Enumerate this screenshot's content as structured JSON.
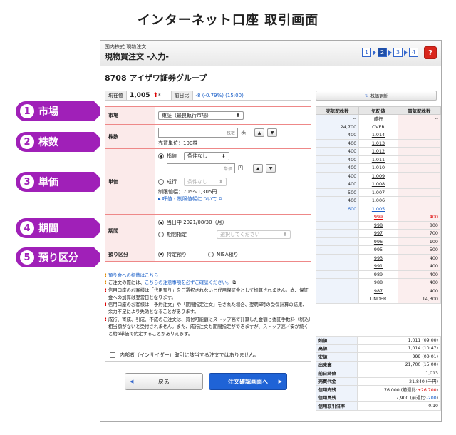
{
  "page_title": "インターネット口座 取引画面",
  "callouts": [
    {
      "num": "1",
      "label": "市場"
    },
    {
      "num": "2",
      "label": "株数"
    },
    {
      "num": "3",
      "label": "単価"
    },
    {
      "num": "4",
      "label": "期間"
    },
    {
      "num": "5",
      "label": "預り区分"
    }
  ],
  "header": {
    "crumb": "国内株式 現物注文",
    "title": "現物買注文 -入力-",
    "steps": [
      "1",
      "2",
      "3",
      "4"
    ],
    "active_step": 2,
    "help": "?"
  },
  "stock": {
    "name": "8708 アイザワ証券グループ",
    "price_label": "現在値",
    "price": "1,005",
    "price_arrow": "⬆",
    "price_mark": "*",
    "change_label": "前日比",
    "change": "-8 (-0.79%) (15:00)",
    "refresh": "株価更新"
  },
  "form": {
    "market_label": "市場",
    "market_value": "東証（最良執行市場）",
    "qty_label": "株数",
    "qty_placeholder": "株数",
    "qty_unit": "株",
    "qty_unit_note": "売買単位：100株",
    "price_label": "単価",
    "limit_label": "指値",
    "limit_cond": "条件なし",
    "price_placeholder": "単価",
    "price_unit": "円",
    "market_order_label": "成行",
    "market_order_cond": "条件なし",
    "price_range": "制限値幅：705～1,305円",
    "quote_link": "呼値・制限値幅について",
    "term_label": "期間",
    "term_today": "当日中 2021/08/30（月）",
    "term_specify": "期間指定",
    "term_select": "選択してください",
    "deposit_label": "預り区分",
    "deposit_special": "特定預り",
    "deposit_nisa": "NISA預り"
  },
  "notes": [
    {
      "icon": "!",
      "type": "o",
      "text": "預り金への振替はこちら",
      "blue": true
    },
    {
      "icon": "!",
      "type": "o",
      "text_pre": "ご注文の際には、",
      "text_link": "こちらの注意事項を必ずご確認ください。",
      "text_post": ""
    },
    {
      "icon": "!",
      "type": "r",
      "text": "信用口座のお客様は「代用預り」をご選択されないと代用保証金として加算されません。尚、保証金への加算は翌営日となります。"
    },
    {
      "icon": "!",
      "type": "r",
      "text": "信用口座のお客様は「予約注文」や「期間指定注文」をされた場合、翌朝6時の受保計算の結果、余力不足により失効となることがあります。"
    },
    {
      "icon": "!",
      "type": "r",
      "text": "成行、寄成、引成、不成のご注文は、買付可能額にストップ高で計算した金額と委託手数料（税込）相当額がないと受付されません。また、成行注文も期間指定ができますが、ストップ高／安が続くと約a単価で約定することがありえます。"
    }
  ],
  "insider": "内部者（インサイダー）取引に該当する注文ではありません。",
  "buttons": {
    "back": "戻る",
    "next": "注文確認画面へ"
  },
  "board": {
    "headers": [
      "売気配株数",
      "気配値",
      "買気配株数"
    ],
    "rows": [
      {
        "ask": "--",
        "price": "成行",
        "bid": "--",
        "plain": true
      },
      {
        "ask": "24,700",
        "price": "OVER",
        "bid": "",
        "plain": true
      },
      {
        "ask": "400",
        "price": "1,014",
        "bid": ""
      },
      {
        "ask": "400",
        "price": "1,013",
        "bid": ""
      },
      {
        "ask": "400",
        "price": "1,012",
        "bid": ""
      },
      {
        "ask": "400",
        "price": "1,011",
        "bid": ""
      },
      {
        "ask": "400",
        "price": "1,010",
        "bid": ""
      },
      {
        "ask": "400",
        "price": "1,009",
        "bid": ""
      },
      {
        "ask": "400",
        "price": "1,008",
        "bid": ""
      },
      {
        "ask": "500",
        "price": "1,007",
        "bid": ""
      },
      {
        "ask": "400",
        "price": "1,006",
        "bid": ""
      },
      {
        "ask": "600",
        "price": "1,005",
        "bid": "",
        "blue": true
      },
      {
        "ask": "",
        "price": "999",
        "bid": "400",
        "red": true
      },
      {
        "ask": "",
        "price": "998",
        "bid": "800"
      },
      {
        "ask": "",
        "price": "997",
        "bid": "700"
      },
      {
        "ask": "",
        "price": "996",
        "bid": "100"
      },
      {
        "ask": "",
        "price": "995",
        "bid": "500"
      },
      {
        "ask": "",
        "price": "993",
        "bid": "400"
      },
      {
        "ask": "",
        "price": "991",
        "bid": "400"
      },
      {
        "ask": "",
        "price": "989",
        "bid": "400"
      },
      {
        "ask": "",
        "price": "988",
        "bid": "400"
      },
      {
        "ask": "",
        "price": "987",
        "bid": "400"
      },
      {
        "ask": "",
        "price": "UNDER",
        "bid": "14,300",
        "plain": true
      }
    ]
  },
  "stats": [
    {
      "k": "始値",
      "v": "1,011 (09:00)"
    },
    {
      "k": "高値",
      "v": "1,014 (10:47)"
    },
    {
      "k": "安値",
      "v": "999 (09:01)"
    },
    {
      "k": "出来高",
      "v": "21,700 (15:00)"
    },
    {
      "k": "前日終値",
      "v": "1,013"
    },
    {
      "k": "売買代金",
      "v": "21,840 (千円)"
    },
    {
      "k": "信用売残",
      "v_pre": "76,000 (前週比:",
      "v_hl": "+26,700",
      "v_post": ")",
      "hl": "red"
    },
    {
      "k": "信用買残",
      "v_pre": "7,900 (前週比:",
      "v_hl": "-200",
      "v_post": ")",
      "hl": "blue"
    },
    {
      "k": "信用取引倍率",
      "v": "0.10"
    }
  ]
}
